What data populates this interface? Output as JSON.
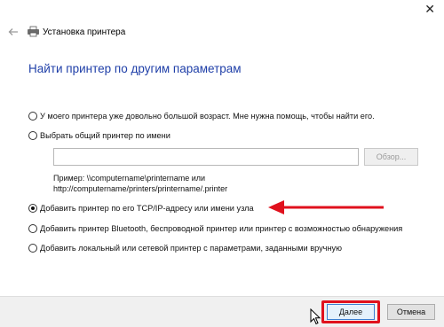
{
  "window": {
    "close_icon": "close-icon",
    "title": "Установка принтера"
  },
  "heading": "Найти принтер по другим параметрам",
  "options": [
    {
      "label": "У моего принтера уже довольно большой возраст. Мне нужна помощь, чтобы найти его.",
      "selected": false
    },
    {
      "label": "Выбрать общий принтер по имени",
      "selected": false
    },
    {
      "label": "Добавить принтер по его TCP/IP-адресу или имени узла",
      "selected": true
    },
    {
      "label": "Добавить принтер Bluetooth, беспроводной принтер или принтер с возможностью обнаружения",
      "selected": false
    },
    {
      "label": "Добавить локальный или сетевой принтер с параметрами, заданными вручную",
      "selected": false
    }
  ],
  "shared_printer": {
    "input_value": "",
    "browse_label": "Обзор...",
    "example_line1": "Пример: \\\\computername\\printername или",
    "example_line2": "http://computername/printers/printername/.printer"
  },
  "footer": {
    "next_label": "Далее",
    "cancel_label": "Отмена"
  },
  "annotation_color": "#e0111d",
  "accent_color": "#1f3fa8"
}
